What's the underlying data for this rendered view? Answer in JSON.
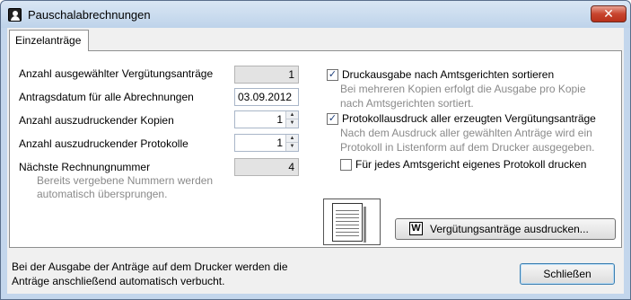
{
  "window": {
    "title": "Pauschalabrechnungen",
    "close_symbol": "✕"
  },
  "tabs": [
    {
      "label": "Einzelanträge",
      "selected": true
    }
  ],
  "left": {
    "count_selected_label": "Anzahl ausgewählter Vergütungsanträge",
    "count_selected_value": "1",
    "date_label": "Antragsdatum für alle Abrechnungen",
    "date_value": "03.09.2012",
    "copies_label": "Anzahl auszudruckender Kopien",
    "copies_value": "1",
    "protocols_label": "Anzahl auszudruckender Protokolle",
    "protocols_value": "1",
    "next_invoice_label": "Nächste Rechnungnummer",
    "next_invoice_value": "4",
    "next_invoice_hint_1": "Bereits vergebene Nummern werden",
    "next_invoice_hint_2": "automatisch übersprungen."
  },
  "right": {
    "sort_label": "Druckausgabe nach Amtsgerichten sortieren",
    "sort_checked": true,
    "sort_hint_1": "Bei mehreren Kopien erfolgt die Ausgabe pro Kopie",
    "sort_hint_2": "nach Amtsgerichten sortiert.",
    "protocol_label": "Protokollausdruck aller erzeugten Vergütungsanträge",
    "protocol_checked": true,
    "protocol_hint_1": "Nach dem Ausdruck aller gewählten Anträge wird ein",
    "protocol_hint_2": "Protokoll in Listenform auf dem Drucker ausgegeben.",
    "per_court_label": "Für jedes Amtsgericht eigenes Protokoll drucken",
    "per_court_checked": false
  },
  "actions": {
    "print_icon_letter": "W",
    "print_label": "Vergütungsanträge ausdrucken...",
    "close_label": "Schließen"
  },
  "footer": {
    "line_1": "Bei der Ausgabe der Anträge auf dem Drucker werden die",
    "line_2": "Anträge anschließend automatisch verbucht."
  },
  "colors": {
    "titlebar": "#c3d6ec",
    "close_button": "#c8452e",
    "panel": "#ffffff",
    "dialog_bg": "#f0f0f0",
    "hint_text": "#8a8a8a"
  },
  "icons": {
    "app": "user-icon",
    "print": "word-document-icon",
    "preview": "document-preview-icon",
    "checkmark": "✓"
  }
}
